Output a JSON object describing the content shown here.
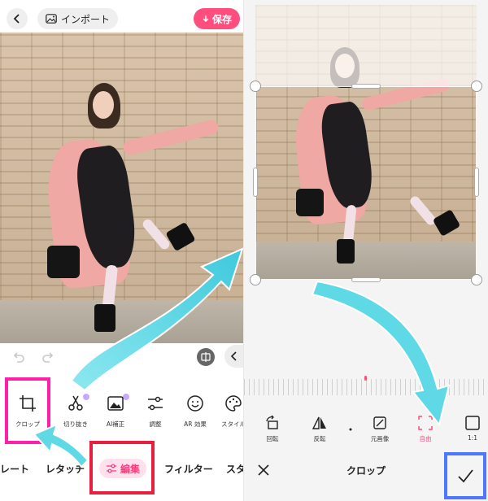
{
  "left": {
    "top_bar": {
      "import_label": "インポート",
      "save_label": "保存"
    },
    "tools": [
      {
        "label": "クロップ",
        "icon": "crop-icon"
      },
      {
        "label": "切り抜き",
        "icon": "scissors-icon"
      },
      {
        "label": "AI補正",
        "icon": "ai-image-icon"
      },
      {
        "label": "調整",
        "icon": "sliders-icon"
      },
      {
        "label": "AR 効果",
        "icon": "smiley-icon"
      },
      {
        "label": "スタイル",
        "icon": "palette-icon"
      }
    ],
    "tabs": {
      "template_partial": "レート",
      "retouch": "レタッチ",
      "edit": "編集",
      "filter": "フィルター",
      "sticker_partial": "スタ"
    }
  },
  "right": {
    "tools": [
      {
        "label": "回転",
        "icon": "rotate-icon"
      },
      {
        "label": "反転",
        "icon": "flip-icon"
      },
      {
        "label": "",
        "icon": "dot-icon"
      },
      {
        "label": "元画像",
        "icon": "original-icon"
      },
      {
        "label": "自由",
        "icon": "free-crop-icon"
      },
      {
        "label": "1:1",
        "icon": "square-icon"
      }
    ],
    "title": "クロップ"
  },
  "colors": {
    "accent_pink": "#ff4d7d",
    "highlight_magenta": "#ff1fa8",
    "highlight_red": "#e81f3f",
    "highlight_blue": "#4b78ff",
    "arrow_cyan": "#5fd9e6"
  }
}
